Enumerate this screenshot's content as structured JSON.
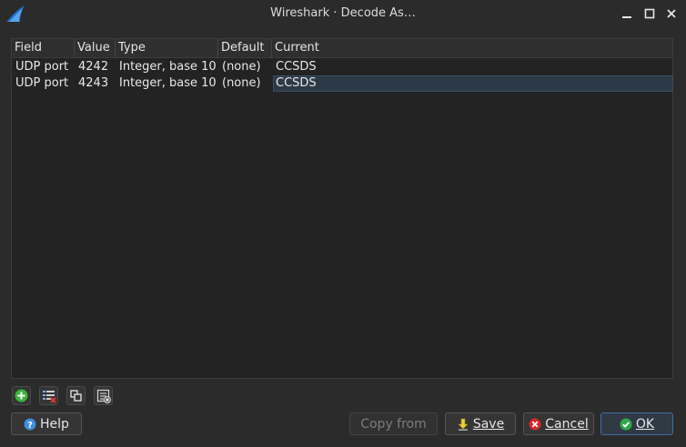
{
  "window": {
    "title": "Wireshark · Decode As…"
  },
  "table": {
    "columns": [
      "Field",
      "Value",
      "Type",
      "Default",
      "Current"
    ],
    "rows": [
      {
        "field": "UDP port",
        "value": "4242",
        "type": "Integer, base 10",
        "default": "(none)",
        "current": "CCSDS"
      },
      {
        "field": "UDP port",
        "value": "4243",
        "type": "Integer, base 10",
        "default": "(none)",
        "current": "CCSDS"
      }
    ]
  },
  "toolbar": {
    "icons": [
      "add-icon",
      "remove-icon",
      "copy-icon",
      "clear-icon"
    ]
  },
  "buttons": {
    "help": "Help",
    "copy_from": "Copy from",
    "save": "Save",
    "cancel": "Cancel",
    "ok": "OK"
  },
  "colors": {
    "accent": "#3f6fa0",
    "add_green": "#3cb43c",
    "cancel_red": "#d9262b",
    "ok_green": "#2ea84a"
  }
}
